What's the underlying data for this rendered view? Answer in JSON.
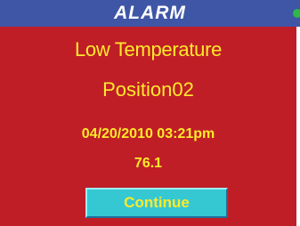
{
  "header": {
    "title": "ALARM",
    "status_indicator_color": "#2eb84a"
  },
  "alarm": {
    "type": "Low Temperature",
    "position": "Position02",
    "timestamp": "04/20/2010 03:21pm",
    "value": "76.1"
  },
  "actions": {
    "continue_label": "Continue"
  },
  "colors": {
    "title_bar": "#3f56a6",
    "panel": "#bf1e27",
    "text": "#ffea2a",
    "button": "#35c8d3"
  }
}
